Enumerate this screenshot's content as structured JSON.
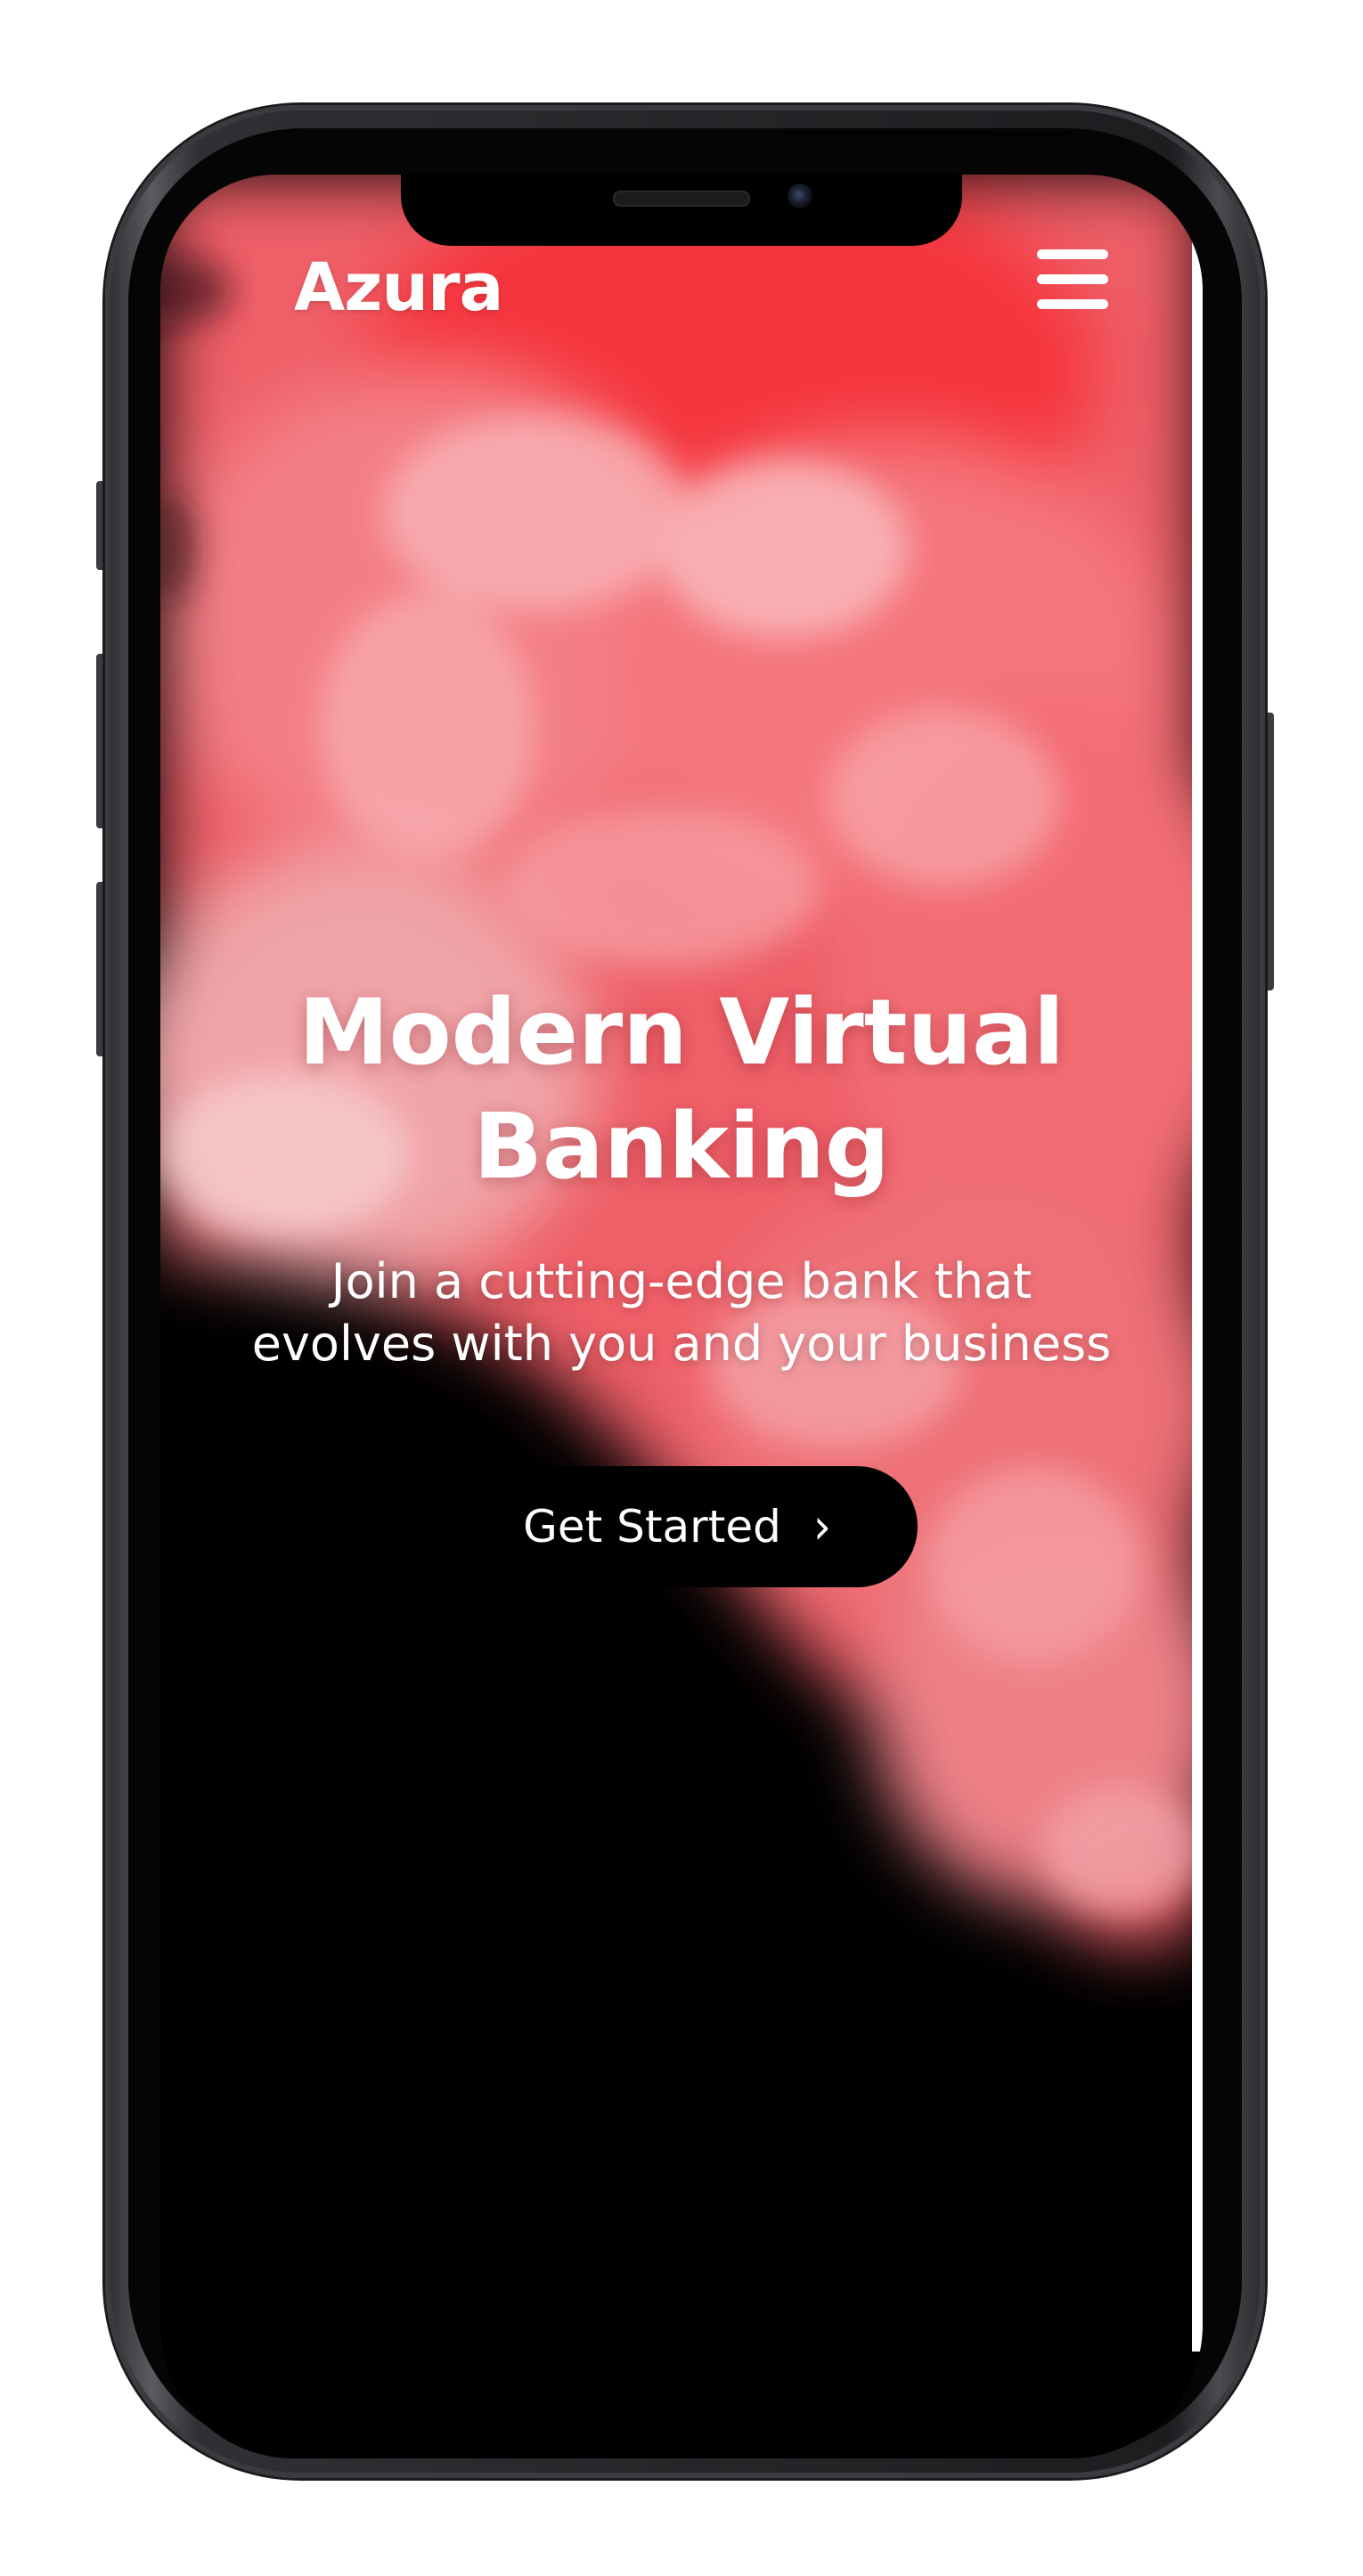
{
  "header": {
    "brand": "Azura",
    "menu_icon": "hamburger-menu-icon"
  },
  "hero": {
    "title_line1": "Modern Virtual",
    "title_line2": "Banking",
    "subtitle_line1": "Join a cutting-edge bank that",
    "subtitle_line2": "evolves with you and your business",
    "cta_label": "Get Started",
    "cta_icon": "chevron-right-icon"
  },
  "colors": {
    "background": "#000000",
    "smoke_primary": "#f0606a",
    "smoke_light": "#f8b0b4",
    "text": "#ffffff",
    "button_bg": "#000000"
  }
}
